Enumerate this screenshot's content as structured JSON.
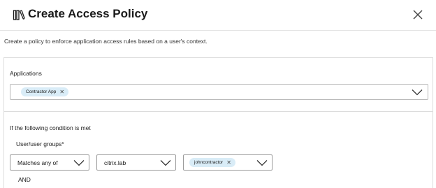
{
  "dialog": {
    "title": "Create Access Policy",
    "intro": "Create a policy to enforce application access rules based on a user's context."
  },
  "applications": {
    "label": "Applications",
    "selected": [
      "Contractor App"
    ]
  },
  "condition": {
    "heading": "If the following condition is met",
    "user_groups_label": "User/user groups*",
    "match_type": "Matches any of",
    "domain": "citrix.lab",
    "users": [
      "johncontractor"
    ],
    "operator": "AND"
  }
}
